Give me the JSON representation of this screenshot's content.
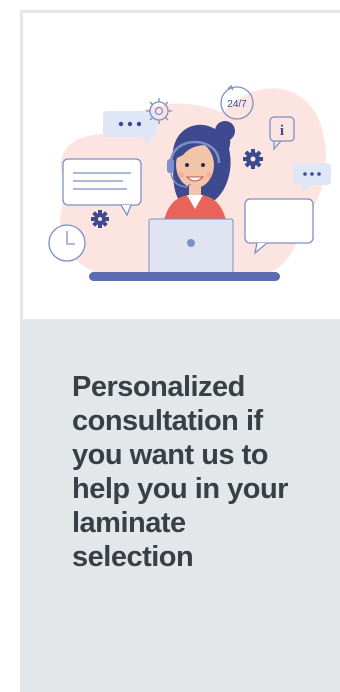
{
  "card": {
    "illustration": {
      "icon": "customer-support-agent-illustration",
      "badge_24_7": "24/7",
      "info_symbol": "i",
      "colors": {
        "blob": "#fce4e1",
        "hair": "#3d4a8f",
        "shirt": "#e8645a",
        "skin": "#f3c5a8",
        "laptop": "#dfe4f0",
        "outline": "#7d8fc7",
        "gear": "#3d4a8f",
        "desk": "#5c6cb3",
        "bubble_fill": "#dfe6f6"
      }
    },
    "headline": "Personalized consultation if you want us to help you in your laminate selection"
  },
  "colors": {
    "card_bg": "#e3e7ea",
    "text": "#3a3f45"
  }
}
